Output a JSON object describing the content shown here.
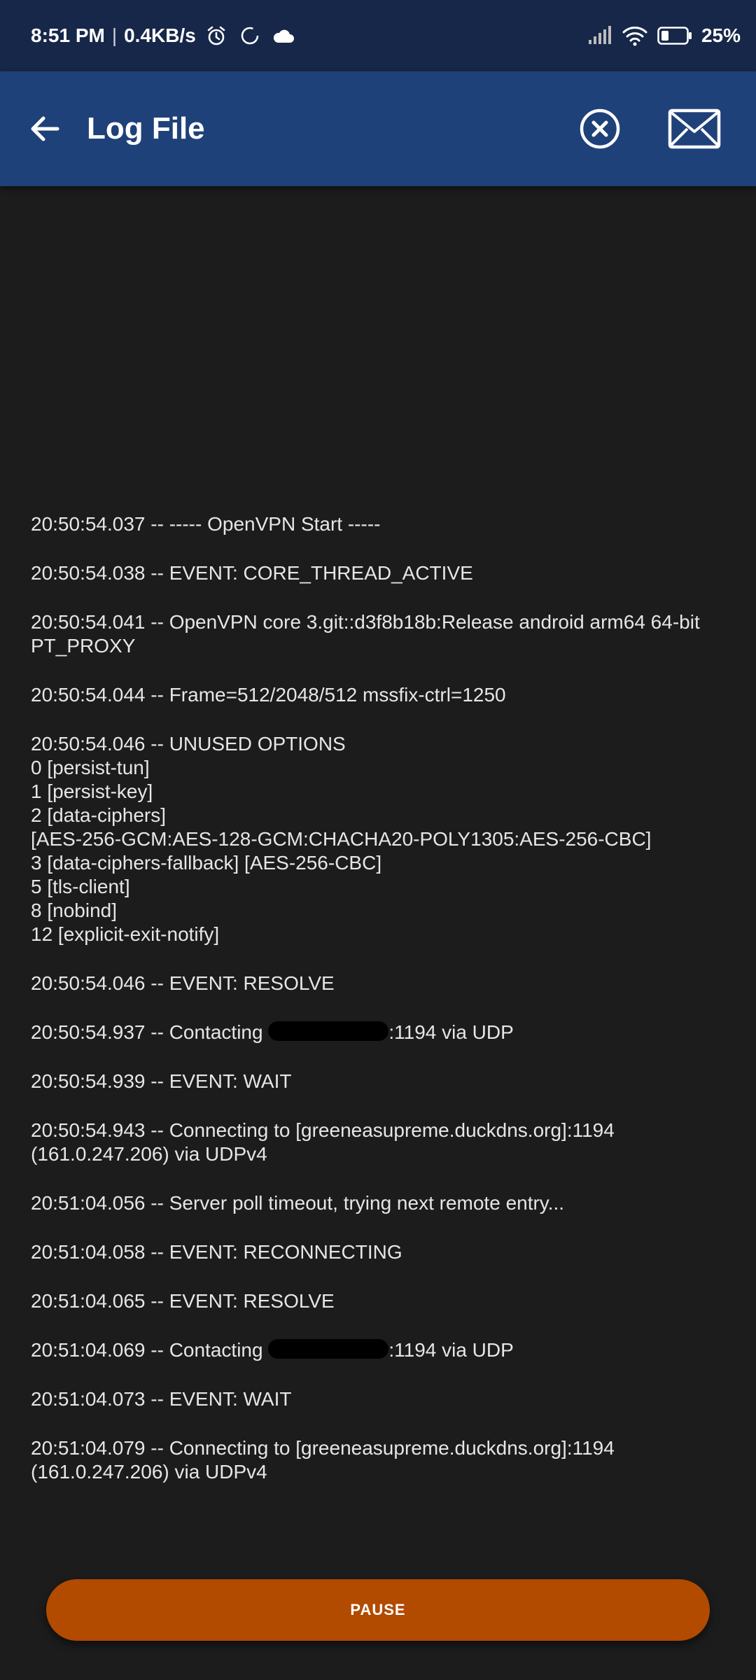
{
  "status_bar": {
    "time": "8:51 PM",
    "separator": "|",
    "net_speed": "0.4KB/s",
    "battery": "25%",
    "icons": [
      "alarm-icon",
      "sync-icon",
      "cloud-icon",
      "signal-icon",
      "wifi-icon",
      "battery-icon"
    ]
  },
  "app_bar": {
    "title": "Log File",
    "back_icon": "arrow-left-icon",
    "clear_icon": "close-circle-icon",
    "mail_icon": "mail-icon"
  },
  "log": {
    "entries": [
      {
        "id": "e1",
        "text": "20:50:54.037 -- ----- OpenVPN Start -----"
      },
      {
        "id": "e2",
        "text": "20:50:54.038 -- EVENT: CORE_THREAD_ACTIVE"
      },
      {
        "id": "e3",
        "text": "20:50:54.041 -- OpenVPN core 3.git::d3f8b18b:Release android arm64 64-bit PT_PROXY"
      },
      {
        "id": "e4",
        "text": "20:50:54.044 -- Frame=512/2048/512 mssfix-ctrl=1250"
      },
      {
        "id": "e5",
        "text": "20:50:54.046 -- UNUSED OPTIONS\n0 [persist-tun]\n1 [persist-key]\n2 [data-ciphers]\n[AES-256-GCM:AES-128-GCM:CHACHA20-POLY1305:AES-256-CBC]\n3 [data-ciphers-fallback] [AES-256-CBC]\n5 [tls-client]\n8 [nobind]\n12 [explicit-exit-notify]"
      },
      {
        "id": "e6",
        "text": "20:50:54.046 -- EVENT: RESOLVE"
      },
      {
        "id": "e7",
        "prefix": "20:50:54.937 -- Contacting ",
        "suffix": ":1194 via UDP"
      },
      {
        "id": "e8",
        "text": "20:50:54.939 -- EVENT: WAIT"
      },
      {
        "id": "e9",
        "text": "20:50:54.943 -- Connecting to [greeneasupreme.duckdns.org]:1194 (161.0.247.206) via UDPv4"
      },
      {
        "id": "e10",
        "text": "20:51:04.056 -- Server poll timeout, trying next remote entry..."
      },
      {
        "id": "e11",
        "text": "20:51:04.058 -- EVENT: RECONNECTING"
      },
      {
        "id": "e12",
        "text": "20:51:04.065 -- EVENT: RESOLVE"
      },
      {
        "id": "e13",
        "prefix": "20:51:04.069 -- Contacting ",
        "suffix": ":1194 via UDP"
      },
      {
        "id": "e14",
        "text": "20:51:04.073 -- EVENT: WAIT"
      },
      {
        "id": "e15",
        "text": "20:51:04.079 -- Connecting to [greeneasupreme.duckdns.org]:1194 (161.0.247.206) via UDPv4"
      }
    ]
  },
  "pause_button": {
    "label": "PAUSE"
  },
  "colors": {
    "status_bar_bg": "#162749",
    "app_bar_bg": "#1f4179",
    "background": "#1c1c1c",
    "accent": "#b24a00"
  }
}
